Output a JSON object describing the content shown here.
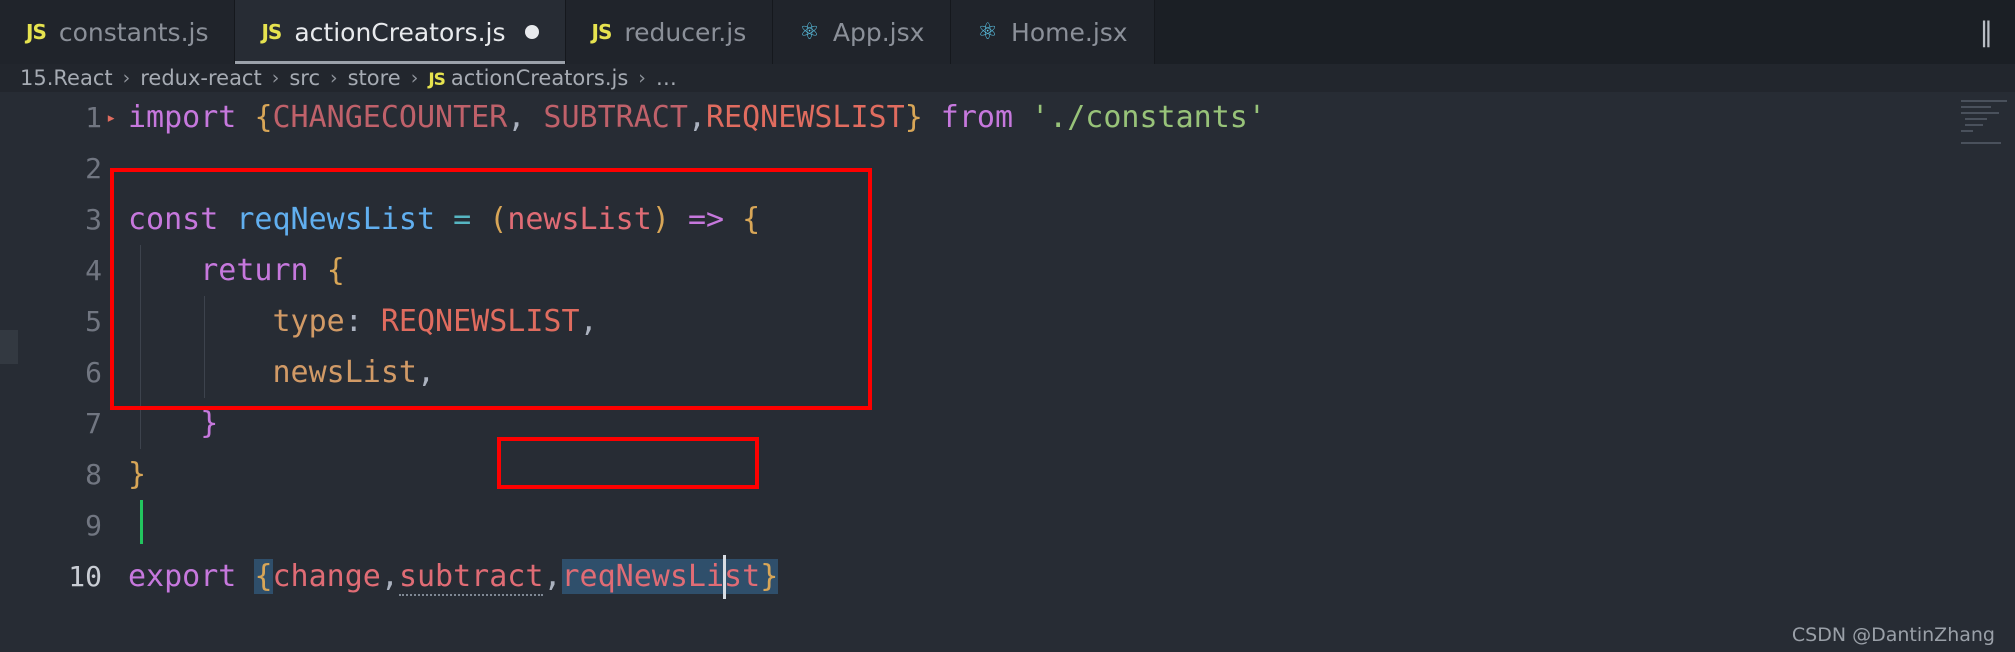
{
  "window": {
    "background": "#22262d",
    "editor_background": "#272c34"
  },
  "tabs": [
    {
      "label": "constants.js",
      "icon": "js-file-icon",
      "icon_glyph": "JS",
      "active": false,
      "dirty": false
    },
    {
      "label": "actionCreators.js",
      "icon": "js-file-icon",
      "icon_glyph": "JS",
      "active": true,
      "dirty": true
    },
    {
      "label": "reducer.js",
      "icon": "js-file-icon",
      "icon_glyph": "JS",
      "active": false,
      "dirty": false
    },
    {
      "label": "App.jsx",
      "icon": "react-file-icon",
      "icon_glyph": "⚛",
      "active": false,
      "dirty": false
    },
    {
      "label": "Home.jsx",
      "icon": "react-file-icon",
      "icon_glyph": "⚛",
      "active": false,
      "dirty": false
    }
  ],
  "tabbar_actions": {
    "split_editor_glyph": "‖",
    "split_editor_label": "Split Editor"
  },
  "breadcrumb": {
    "separator": "›",
    "items": [
      {
        "label": "15.React",
        "icon": null
      },
      {
        "label": "redux-react",
        "icon": null
      },
      {
        "label": "src",
        "icon": null
      },
      {
        "label": "store",
        "icon": null
      },
      {
        "label": "actionCreators.js",
        "icon": "js-file-icon",
        "icon_glyph": "JS"
      },
      {
        "label": "…",
        "icon": null
      }
    ]
  },
  "editor": {
    "language": "javascript",
    "file": "actionCreators.js",
    "lines": [
      {
        "number": "1",
        "indent": 0,
        "tokens": [
          {
            "text": "import ",
            "kind": "kw"
          },
          {
            "text": "{",
            "kind": "punc"
          },
          {
            "text": "CHANGECOUNTER",
            "kind": "const-id"
          },
          {
            "text": ",",
            "kind": "comma"
          },
          {
            "text": " SUBTRACT",
            "kind": "const-id"
          },
          {
            "text": ",",
            "kind": "comma"
          },
          {
            "text": "REQNEWSLIST",
            "kind": "const-hi"
          },
          {
            "text": "}",
            "kind": "punc"
          },
          {
            "text": " from ",
            "kind": "kw"
          },
          {
            "text": "'./constants'",
            "kind": "str"
          }
        ]
      },
      {
        "number": "2",
        "indent": 0,
        "tokens": []
      },
      {
        "number": "3",
        "indent": 0,
        "tokens": [
          {
            "text": "const ",
            "kind": "kw"
          },
          {
            "text": "reqNewsList",
            "kind": "fn"
          },
          {
            "text": " ",
            "kind": "plain"
          },
          {
            "text": "=",
            "kind": "op"
          },
          {
            "text": " ",
            "kind": "plain"
          },
          {
            "text": "(",
            "kind": "punc"
          },
          {
            "text": "newsList",
            "kind": "param"
          },
          {
            "text": ")",
            "kind": "punc"
          },
          {
            "text": " ",
            "kind": "plain"
          },
          {
            "text": "=>",
            "kind": "kw"
          },
          {
            "text": " ",
            "kind": "plain"
          },
          {
            "text": "{",
            "kind": "punc"
          }
        ]
      },
      {
        "number": "4",
        "indent": 1,
        "tokens": [
          {
            "text": "    return ",
            "kind": "kw"
          },
          {
            "text": "{",
            "kind": "punc"
          }
        ]
      },
      {
        "number": "5",
        "indent": 2,
        "tokens": [
          {
            "text": "        type",
            "kind": "prop"
          },
          {
            "text": ":",
            "kind": "plain"
          },
          {
            "text": " REQNEWSLIST",
            "kind": "const-hi"
          },
          {
            "text": ",",
            "kind": "comma"
          }
        ]
      },
      {
        "number": "6",
        "indent": 2,
        "tokens": [
          {
            "text": "        newsList",
            "kind": "prop"
          },
          {
            "text": ",",
            "kind": "comma"
          }
        ]
      },
      {
        "number": "7",
        "indent": 1,
        "tokens": [
          {
            "text": "    ",
            "kind": "plain"
          },
          {
            "text": "}",
            "kind": "brace-p"
          }
        ]
      },
      {
        "number": "8",
        "indent": 0,
        "tokens": [
          {
            "text": "}",
            "kind": "punc"
          }
        ]
      },
      {
        "number": "9",
        "indent": 0,
        "tokens": [],
        "cursor_green": true
      },
      {
        "number": "10",
        "indent": 0,
        "current": true,
        "tokens": [
          {
            "text": "export ",
            "kind": "kw"
          },
          {
            "text": "{",
            "kind": "punc",
            "selected": true
          },
          {
            "text": "change",
            "kind": "param"
          },
          {
            "text": ",",
            "kind": "comma"
          },
          {
            "text": "subtract",
            "kind": "param",
            "squiggle": true
          },
          {
            "text": ",",
            "kind": "comma"
          },
          {
            "text": "reqNewsList",
            "kind": "param",
            "selected": true
          },
          {
            "text": "}",
            "kind": "punc",
            "selected": true
          }
        ]
      }
    ]
  },
  "annotations": [
    {
      "name": "function-block-highlight",
      "color": "#fe0000",
      "covers": "lines 3-8 const reqNewsList block"
    },
    {
      "name": "export-token-highlight",
      "color": "#fe0000",
      "covers": "reqNewsList in export statement on line 10"
    }
  ],
  "watermark": {
    "text": "CSDN @DantinZhang"
  },
  "colors": {
    "accent_red": "#fe0000",
    "keyword": "#c678dd",
    "punctuation": "#d8a657",
    "constant": "#bf616a",
    "constant_highlight": "#e06c5f",
    "string": "#98c379",
    "function": "#61afef",
    "operator": "#56b6c2",
    "parameter": "#e06c75",
    "property": "#d19a66",
    "js_icon": "#e6e34f",
    "react_icon": "#5cc6e8"
  }
}
